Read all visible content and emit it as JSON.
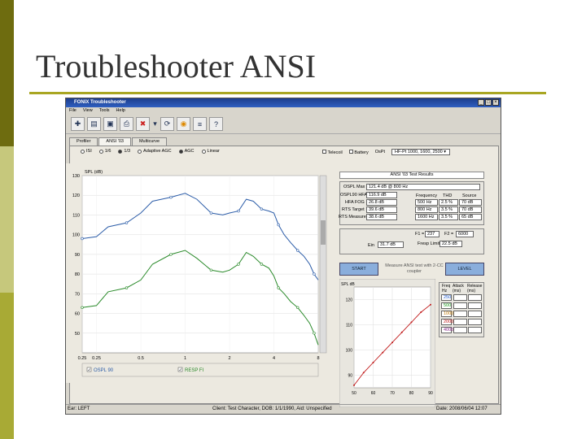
{
  "slide": {
    "title": "Troubleshooter ANSI"
  },
  "window": {
    "title": "FONIX Troubleshooter",
    "controls": [
      "_",
      "□",
      "×"
    ],
    "menu": [
      "File",
      "View",
      "Tools",
      "Help"
    ],
    "tabs": [
      "Profiler",
      "ANSI '03",
      "Multicurve"
    ],
    "active_tab": "ANSI '03",
    "radio_options": [
      "ISI",
      "1/6",
      "1/3",
      "Adaptive AGC",
      "AGC",
      "Linear"
    ],
    "checkbox_telecoil": "Telecoil",
    "checkbox_battery": "Battery",
    "dropdown_label": "OsPt",
    "dropdown_value": "HF-Pt 1000, 1600, 2500"
  },
  "graph": {
    "y_axis_label": "SPL (dB)",
    "y_ticks": [
      "130",
      "120",
      "110",
      "100",
      "90",
      "80",
      "70",
      "60",
      "50"
    ],
    "x_ticks": [
      "0.25",
      "0.25",
      "0.5",
      "1",
      "2",
      "4",
      "8"
    ],
    "legend": [
      {
        "label": "OSPL 90",
        "color": "#2b5ca8",
        "checked": true
      },
      {
        "label": "RESP FI",
        "color": "#2a8a2a",
        "checked": true
      }
    ]
  },
  "results": {
    "header": "ANSI '03 Test Results",
    "ospl_max_label": "OSPL Max",
    "ospl_max": "121.4 dB @ 800 Hz",
    "ospl_hfa_label": "OSPL90 HFA",
    "ospl_hfa": "116.9 dB",
    "hfa_fog_label": "HFA FOG",
    "hfa_fog": "26.8 dB",
    "rts_target_label": "RTS Target",
    "rts_target": "39.6 dB",
    "rts_measured_label": "RTS Measured",
    "rts_measured": "38.6 dB",
    "thd_headers": [
      "Frequency",
      "THD",
      "Source"
    ],
    "thd_rows": [
      [
        "500 Hz",
        "2.5 %",
        "70 dB"
      ],
      [
        "800 Hz",
        "3.5 %",
        "70 dB"
      ],
      [
        "1600 Hz",
        "3.5 %",
        "65 dB"
      ]
    ],
    "f1_label": "F1 =",
    "f1_value": "237",
    "f2_label": "F2 =",
    "f2_value": "6000",
    "ein_label": "Ein",
    "ein_value": "31.7 dB",
    "fresp_label": "Fresp Limit",
    "fresp_value": "22.5 dB",
    "start_button": "START",
    "level_button": "LEVEL",
    "measure_text": "Measure ANSI test with 2-CC coupler"
  },
  "io_graph": {
    "y_label": "SPL dB",
    "y_ticks": [
      "120",
      "110",
      "100",
      "90"
    ],
    "x_ticks": [
      "50",
      "60",
      "70",
      "80",
      "90"
    ]
  },
  "attack_release": {
    "headers": [
      "Freq Hz",
      "Attack (ms)",
      "Release (ms)"
    ],
    "freqs": [
      "250",
      "500",
      "1000",
      "2000",
      "4000"
    ],
    "freq_colors": [
      "#1a56c8",
      "#1a9a1a",
      "#c07800",
      "#c01818",
      "#8a2a8a"
    ]
  },
  "status": {
    "ear": "Ear: LEFT",
    "client": "Client: Test Character,  DOB: 1/1/1990,  Aid: Unspecified",
    "date": "Date: 2008/06/04  12:07"
  },
  "chart_data": {
    "type": "line",
    "title": "",
    "xlabel": "",
    "ylabel": "SPL (dB)",
    "xscale": "log",
    "xlim": [
      0.2,
      8
    ],
    "ylim": [
      40,
      130
    ],
    "series": [
      {
        "name": "OSPL 90",
        "color": "#2b5ca8",
        "points": [
          [
            0.2,
            98
          ],
          [
            0.25,
            99
          ],
          [
            0.3,
            104
          ],
          [
            0.4,
            106
          ],
          [
            0.5,
            111
          ],
          [
            0.6,
            117
          ],
          [
            0.8,
            119
          ],
          [
            1.0,
            121
          ],
          [
            1.2,
            118
          ],
          [
            1.5,
            111
          ],
          [
            1.8,
            110
          ],
          [
            2.0,
            111
          ],
          [
            2.3,
            112
          ],
          [
            2.6,
            118
          ],
          [
            2.9,
            117
          ],
          [
            3.3,
            113
          ],
          [
            3.7,
            112
          ],
          [
            4.0,
            111
          ],
          [
            4.3,
            105
          ],
          [
            4.7,
            100
          ],
          [
            5.2,
            96
          ],
          [
            5.8,
            92
          ],
          [
            6.4,
            89
          ],
          [
            7.0,
            85
          ],
          [
            7.5,
            80
          ],
          [
            8.0,
            77
          ]
        ]
      },
      {
        "name": "RESP FI",
        "color": "#2a8a2a",
        "points": [
          [
            0.2,
            63
          ],
          [
            0.25,
            64
          ],
          [
            0.3,
            71
          ],
          [
            0.4,
            73
          ],
          [
            0.5,
            77
          ],
          [
            0.6,
            85
          ],
          [
            0.8,
            90
          ],
          [
            1.0,
            92
          ],
          [
            1.2,
            88
          ],
          [
            1.5,
            82
          ],
          [
            1.8,
            81
          ],
          [
            2.0,
            82
          ],
          [
            2.3,
            85
          ],
          [
            2.6,
            91
          ],
          [
            2.9,
            89
          ],
          [
            3.3,
            85
          ],
          [
            3.7,
            83
          ],
          [
            4.0,
            79
          ],
          [
            4.3,
            73
          ],
          [
            4.7,
            70
          ],
          [
            5.2,
            66
          ],
          [
            5.8,
            63
          ],
          [
            6.4,
            59
          ],
          [
            7.0,
            55
          ],
          [
            7.5,
            50
          ],
          [
            8.0,
            44
          ]
        ]
      }
    ]
  }
}
